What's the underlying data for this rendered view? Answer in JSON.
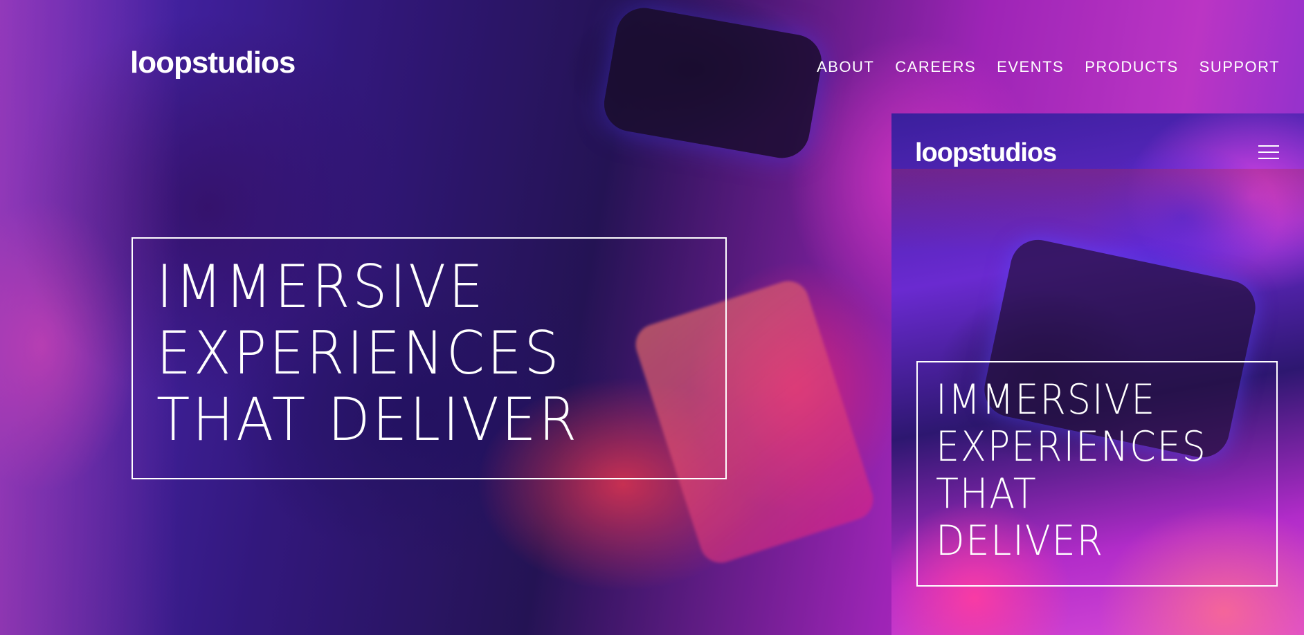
{
  "desktop": {
    "logo": "loopstudios",
    "nav": [
      "ABOUT",
      "CAREERS",
      "EVENTS",
      "PRODUCTS",
      "SUPPORT"
    ],
    "hero_lines": [
      "IMMERSIVE",
      "EXPERIENCES",
      "THAT DELIVER"
    ]
  },
  "mobile": {
    "logo": "loopstudios",
    "menu_icon": "hamburger-icon",
    "hero_lines": [
      "IMMERSIVE",
      "EXPERIENCES",
      "THAT",
      "DELIVER"
    ]
  },
  "colors": {
    "text": "#ffffff",
    "accent_purple": "#6a2ad0",
    "accent_pink": "#d84ad8"
  }
}
